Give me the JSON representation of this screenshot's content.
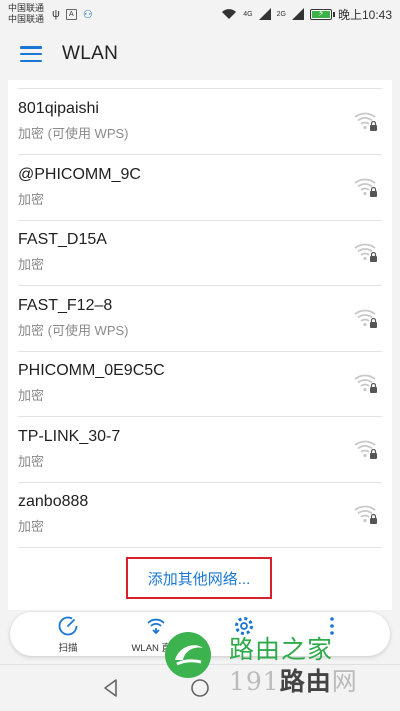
{
  "status_bar": {
    "carrier1": "中国联通",
    "carrier2": "中国联通",
    "net_gen1": "4G",
    "net_gen2": "2G",
    "time": "晚上10:43",
    "battery_level": 1.0
  },
  "header": {
    "title": "WLAN"
  },
  "networks": [
    {
      "ssid": "801qipaishi",
      "security": "加密 (可使用 WPS)",
      "icon": "wifi-locked-icon"
    },
    {
      "ssid": "@PHICOMM_9C",
      "security": "加密",
      "icon": "wifi-locked-icon"
    },
    {
      "ssid": "FAST_D15A",
      "security": "加密",
      "icon": "wifi-locked-icon"
    },
    {
      "ssid": "FAST_F12–8",
      "security": "加密 (可使用 WPS)",
      "icon": "wifi-locked-icon"
    },
    {
      "ssid": "PHICOMM_0E9C5C",
      "security": "加密",
      "icon": "wifi-locked-icon"
    },
    {
      "ssid": "TP-LINK_30-7",
      "security": "加密",
      "icon": "wifi-locked-icon"
    },
    {
      "ssid": "zanbo888",
      "security": "加密",
      "icon": "wifi-locked-icon"
    }
  ],
  "add_network_label": "添加其他网络...",
  "actions": [
    {
      "label": "扫描",
      "icon": "scan-icon"
    },
    {
      "label": "WLAN 直连",
      "icon": "wlan-direct-icon"
    },
    {
      "label": "",
      "icon": "settings-gear-icon"
    },
    {
      "label": "",
      "icon": "more-vertical-icon"
    }
  ],
  "watermark": {
    "line1": "路由之家",
    "line2_prefix": "191",
    "line2_bold": "路由",
    "line2_suffix": "网"
  },
  "colors": {
    "accent": "#1976d2",
    "highlight_border": "#d8202c",
    "watermark_green": "#2eaa4a"
  }
}
